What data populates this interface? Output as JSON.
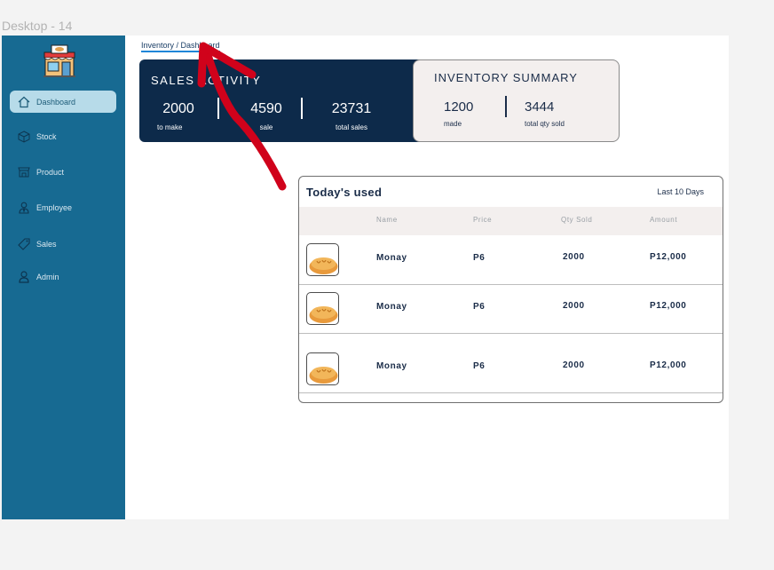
{
  "frame_label": "Desktop - 14",
  "breadcrumb": "Inventory / Dashboard",
  "sidebar": {
    "items": [
      {
        "label": "Dashboard",
        "icon": "home-icon",
        "active": true
      },
      {
        "label": "Stock",
        "icon": "box-icon",
        "active": false
      },
      {
        "label": "Product",
        "icon": "store-icon",
        "active": false
      },
      {
        "label": "Employee",
        "icon": "employee-icon",
        "active": false
      },
      {
        "label": "Sales",
        "icon": "tag-icon",
        "active": false
      },
      {
        "label": "Admin",
        "icon": "user-icon",
        "active": false
      }
    ]
  },
  "sales_activity": {
    "title": "SALES ACTIVITY",
    "stats": [
      {
        "value": "2000",
        "label": "to make"
      },
      {
        "value": "4590",
        "label": "sale"
      },
      {
        "value": "23731",
        "label": "total sales"
      }
    ]
  },
  "inventory_summary": {
    "title": "INVENTORY SUMMARY",
    "stats": [
      {
        "value": "1200",
        "label": "made"
      },
      {
        "value": "3444",
        "label": "total qty sold"
      }
    ]
  },
  "todays_used": {
    "title": "Today's used",
    "period": "Last 10 Days",
    "columns": [
      "Name",
      "Price",
      "Qty Sold",
      "Amount"
    ],
    "rows": [
      {
        "name": "Monay",
        "price": "P6",
        "qty": "2000",
        "amount": "P12,000"
      },
      {
        "name": "Monay",
        "price": "P6",
        "qty": "2000",
        "amount": "P12,000"
      },
      {
        "name": "Monay",
        "price": "P6",
        "qty": "2000",
        "amount": "P12,000"
      }
    ]
  },
  "colors": {
    "sidebar": "#176a92",
    "sales_card": "#0d2a4a",
    "arrow": "#d0021b",
    "active_nav": "#b7dbe9"
  }
}
